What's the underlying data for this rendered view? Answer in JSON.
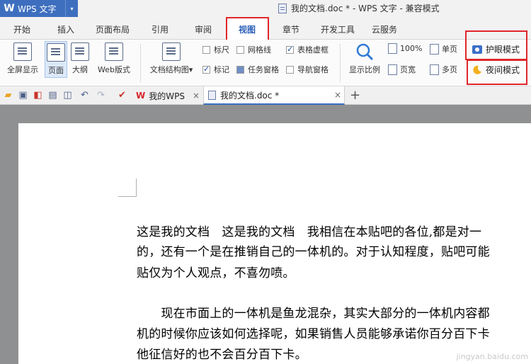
{
  "titlebar": {
    "app_logo": "W",
    "app_name": "WPS 文字",
    "app_menu_arrow": "▾",
    "document_title": "我的文档.doc * - WPS 文字 - 兼容模式"
  },
  "tabs": [
    {
      "label": "开始"
    },
    {
      "label": "插入"
    },
    {
      "label": "页面布局"
    },
    {
      "label": "引用"
    },
    {
      "label": "审阅"
    },
    {
      "label": "视图",
      "active": true
    },
    {
      "label": "章节"
    },
    {
      "label": "开发工具"
    },
    {
      "label": "云服务"
    }
  ],
  "ribbon": {
    "view_buttons": [
      {
        "label": "全屏显示"
      },
      {
        "label": "页面",
        "pressed": true
      },
      {
        "label": "大纲"
      },
      {
        "label": "Web版式"
      }
    ],
    "doc_structure": "文档结构图",
    "doc_structure_arrow": "▾",
    "checkboxes": [
      {
        "label": "标尺",
        "checked": false
      },
      {
        "label": "网格线",
        "checked": false
      },
      {
        "label": "表格虚框",
        "checked": true
      },
      {
        "label": "标记",
        "checked": true
      },
      {
        "label": "任务窗格",
        "checked": false
      },
      {
        "label": "导航窗格",
        "checked": false
      }
    ],
    "zoom_button": "显示比例",
    "zoom_percent": "100%",
    "page_width": "页宽",
    "single_page": "单页",
    "multi_page": "多页",
    "eye_protection": "护眼模式",
    "night_mode": "夜间模式"
  },
  "quickbar": {
    "doc_tabs": [
      {
        "label": "我的WPS",
        "close": "×"
      },
      {
        "label": "我的文档.doc *",
        "close": "×",
        "active": true
      }
    ],
    "new_tab": "+"
  },
  "document": {
    "lines": [
      "这是我的文档　这是我的文档　我相信在本贴吧的各位,都是对一",
      "的，还有一个是在推销自己的一体机的。对于认知程度，贴吧可能",
      "贴仅为个人观点，不喜勿喷。",
      "",
      "　　现在市面上的一体机是鱼龙混杂，其实大部分的一体机内容都",
      "机的时候你应该如何选择呢，如果销售人员能够承诺你百分百下卡",
      "他征信好的也不会百分百下卡。"
    ],
    "watermark": "jingyan.baidu.com"
  },
  "colors": {
    "accent": "#3e6fbf",
    "highlight_box": "#e0262b",
    "doc_background": "#8f9091"
  }
}
